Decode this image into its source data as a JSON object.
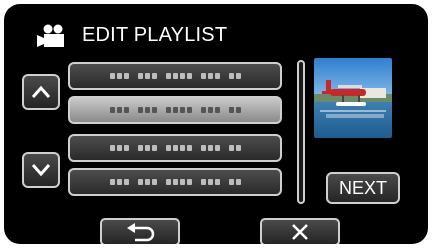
{
  "header": {
    "icon": "video-camera-icon",
    "title": "EDIT PLAYLIST"
  },
  "nav": {
    "up_icon": "chevron-up-icon",
    "down_icon": "chevron-down-icon"
  },
  "playlist": {
    "rows": [
      {
        "selected": false
      },
      {
        "selected": true
      },
      {
        "selected": false
      },
      {
        "selected": false
      }
    ]
  },
  "preview": {
    "thumbnail": "seaplane-thumbnail"
  },
  "buttons": {
    "next_label": "NEXT",
    "back_icon": "return-arrow-icon",
    "close_icon": "close-icon"
  },
  "colors": {
    "background": "#000000",
    "button_border": "#cfcfcf",
    "text": "#ffffff"
  }
}
